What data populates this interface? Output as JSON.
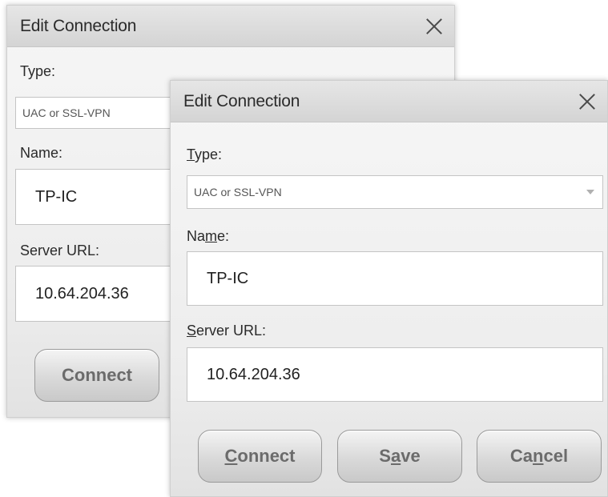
{
  "back_dialog": {
    "title": "Edit Connection",
    "type_label": "Type:",
    "type_value": "UAC or SSL-VPN",
    "name_label": "Name:",
    "name_value": "TP-IC",
    "url_label": "Server URL:",
    "url_value": "10.64.204.36",
    "connect_label": "Connect"
  },
  "front_dialog": {
    "title": "Edit Connection",
    "type_label_mn": "T",
    "type_label_rest": "ype:",
    "type_value": "UAC or SSL-VPN",
    "name_label_pre": "Na",
    "name_label_mn": "m",
    "name_label_post": "e:",
    "name_value": "TP-IC",
    "url_label_mn": "S",
    "url_label_rest": "erver URL:",
    "url_value": "10.64.204.36",
    "connect_mn": "C",
    "connect_rest": "onnect",
    "save_pre": "S",
    "save_mn": "a",
    "save_post": "ve",
    "cancel_pre": "Ca",
    "cancel_mn": "n",
    "cancel_post": "cel"
  }
}
